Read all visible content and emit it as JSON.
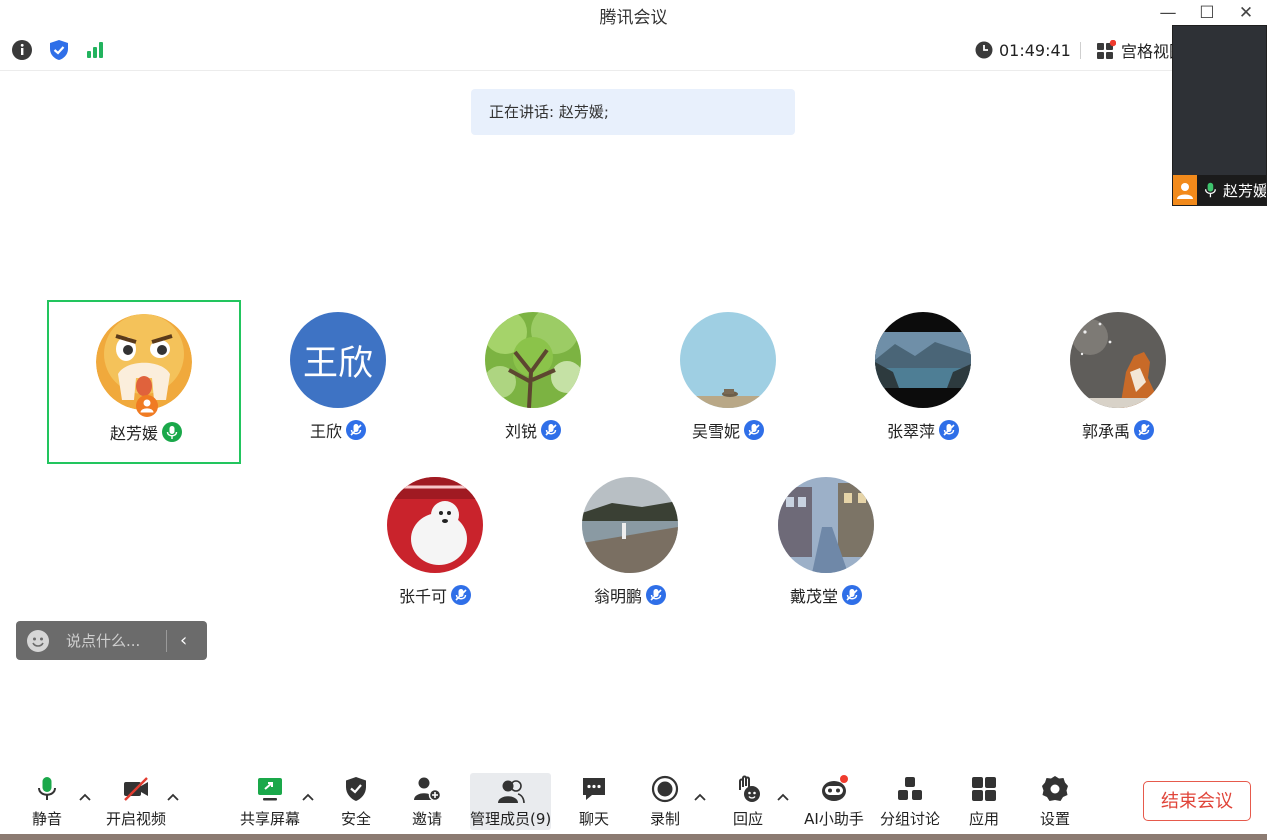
{
  "window": {
    "title": "腾讯会议",
    "controls": [
      "—",
      "☐",
      "✕"
    ]
  },
  "infobar": {
    "timer": "01:49:41",
    "view_label": "宫格视图"
  },
  "self_view": {
    "name": "赵芳媛"
  },
  "speaking": {
    "text": "正在讲话: 赵芳媛;"
  },
  "participants": [
    {
      "name": "赵芳媛",
      "avatar": "cartoon-face",
      "mic": "on"
    },
    {
      "name": "王欣",
      "avatar": "text",
      "avatar_text": "王欣",
      "mic": "muted"
    },
    {
      "name": "刘锐",
      "avatar": "tree-photo",
      "mic": "muted"
    },
    {
      "name": "吴雪妮",
      "avatar": "sky-photo",
      "mic": "muted"
    },
    {
      "name": "张翠萍",
      "avatar": "lake-photo",
      "mic": "muted"
    },
    {
      "name": "郭承禹",
      "avatar": "fox-photo",
      "mic": "muted"
    },
    {
      "name": "张千可",
      "avatar": "polar-bear-photo",
      "mic": "muted"
    },
    {
      "name": "翁明鹏",
      "avatar": "beach-photo",
      "mic": "muted"
    },
    {
      "name": "戴茂堂",
      "avatar": "street-photo",
      "mic": "muted"
    }
  ],
  "chat": {
    "placeholder": "说点什么...",
    "collapse": "‹"
  },
  "toolbar": {
    "mute": "静音",
    "video": "开启视频",
    "share": "共享屏幕",
    "security": "安全",
    "invite": "邀请",
    "members": "管理成员(9)",
    "chat": "聊天",
    "record": "录制",
    "react": "回应",
    "ai": "AI小助手",
    "breakout": "分组讨论",
    "apps": "应用",
    "settings": "设置",
    "end": "结束会议"
  },
  "colors": {
    "accent_blue": "#2f6fe8",
    "active_green": "#22c55e",
    "end_red": "#e0453a"
  }
}
